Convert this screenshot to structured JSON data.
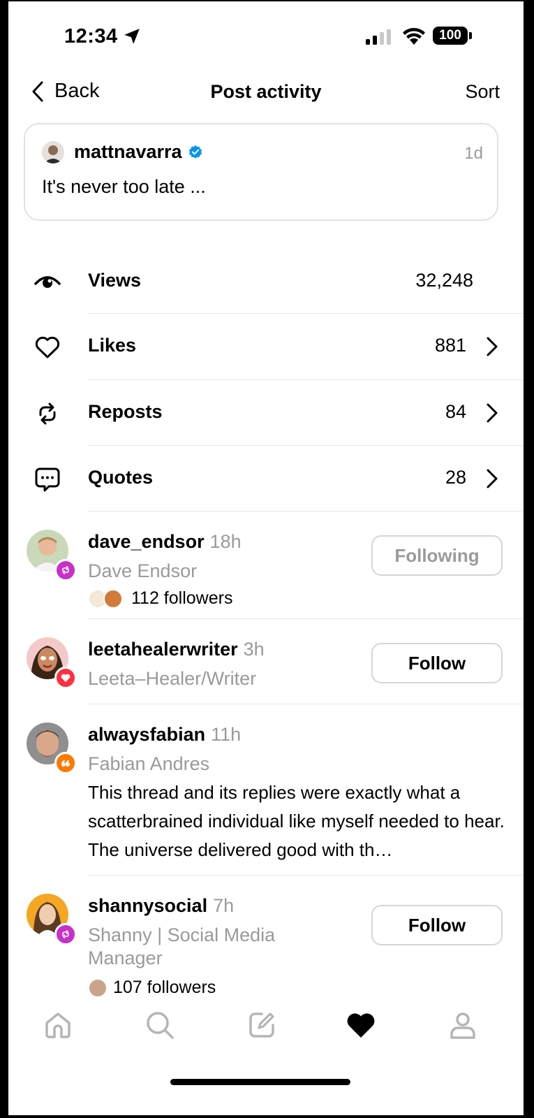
{
  "status_bar": {
    "time": "12:34",
    "battery": "100"
  },
  "header": {
    "back_label": "Back",
    "title": "Post activity",
    "sort_label": "Sort"
  },
  "post": {
    "username": "mattnavarra",
    "time": "1d",
    "text": "It's never too late ..."
  },
  "stats": [
    {
      "label": "Views",
      "value": "32,248",
      "icon": "eye-icon"
    },
    {
      "label": "Likes",
      "value": "881",
      "icon": "heart-icon"
    },
    {
      "label": "Reposts",
      "value": "84",
      "icon": "repost-icon"
    },
    {
      "label": "Quotes",
      "value": "28",
      "icon": "quote-icon"
    }
  ],
  "activity": [
    {
      "username": "dave_endsor",
      "ago": "18h",
      "full_name": "Dave Endsor",
      "followers": "112 followers",
      "button": "Following",
      "badge": "repost-icon",
      "badge_color": "#c930c8"
    },
    {
      "username": "leetahealerwriter",
      "ago": "3h",
      "full_name": "Leeta–Healer/Writer",
      "button": "Follow",
      "badge": "heart-icon",
      "badge_color": "#ff3040"
    },
    {
      "username": "alwaysfabian",
      "ago": "11h",
      "full_name": "Fabian Andres",
      "quote": "This thread and its replies were exactly what a scatterbrained individual like myself needed to hear. The universe delivered good with th…",
      "badge": "quote-icon",
      "badge_color": "#fe7900"
    },
    {
      "username": "shannysocial",
      "ago": "7h",
      "full_name_line1": "Shanny | Social Media",
      "full_name_line2": "Manager",
      "followers": "107 followers",
      "button": "Follow",
      "badge": "repost-icon",
      "badge_color": "#c930c8"
    }
  ],
  "tabs": [
    "home-icon",
    "search-icon",
    "compose-icon",
    "activity-heart-icon",
    "profile-icon"
  ],
  "colors": {
    "verified": "#0095f6",
    "secondary_text": "#9a9a9a",
    "divider": "#e6e6e6"
  }
}
